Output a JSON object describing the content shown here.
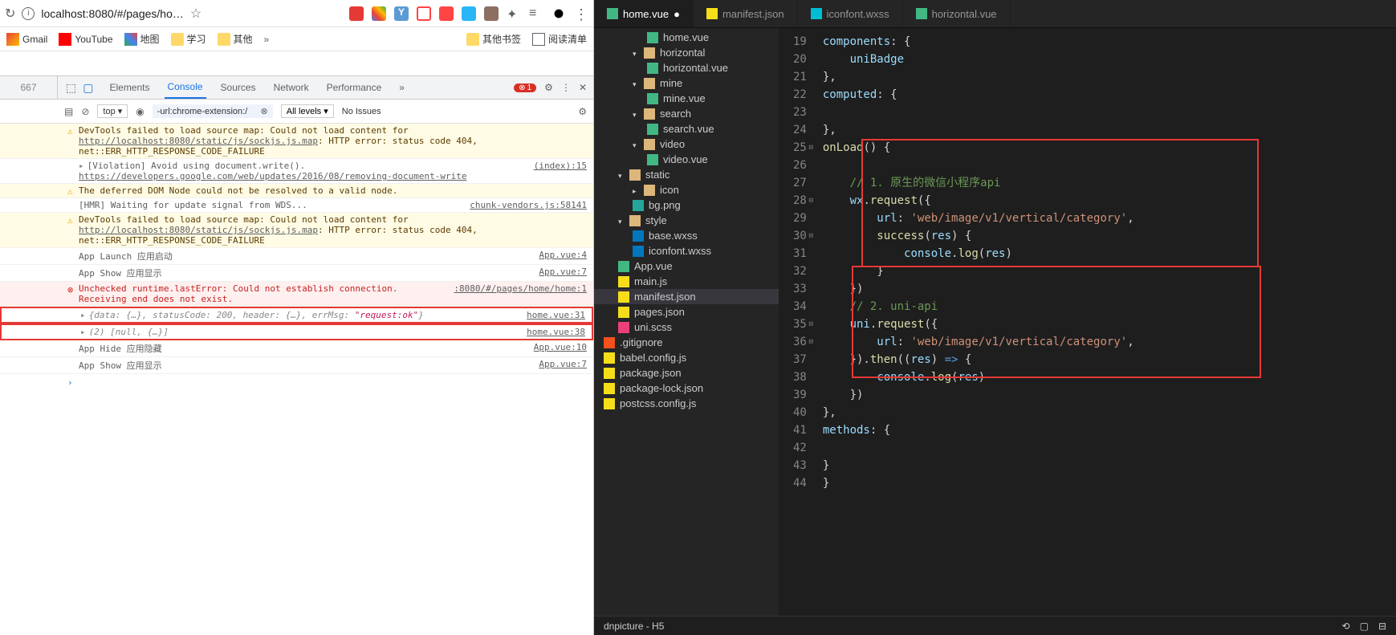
{
  "chrome": {
    "url": "localhost:8080/#/pages/ho…",
    "bookmarks": {
      "gmail": "Gmail",
      "youtube": "YouTube",
      "map": "地图",
      "study": "学习",
      "other": "其他",
      "other_bm": "其他书签",
      "reading": "阅读清单"
    },
    "side_num": "667"
  },
  "devtools": {
    "tabs": {
      "elements": "Elements",
      "console": "Console",
      "sources": "Sources",
      "network": "Network",
      "performance": "Performance"
    },
    "more": "»",
    "err_count": "1",
    "context": "top ▾",
    "filter": "-url:chrome-extension:/",
    "levels": "All levels ▾",
    "issues": "No Issues"
  },
  "console_msgs": {
    "m1": "DevTools failed to load source map: Could not load content for ",
    "m1_link": "http://localhost:8080/static/js/sockjs.js.map",
    "m1_tail": ": HTTP error: status code 404, net::ERR_HTTP_RESPONSE_CODE_FAILURE",
    "m2": "[Violation] Avoid using document.write(). ",
    "m2_link": "https://developers.google.com/web/updates/2016/08/removing-document-write",
    "m2_src": "(index):15",
    "m3": "The deferred DOM Node could not be resolved to a valid node.",
    "m4": "[HMR] Waiting for update signal from WDS...",
    "m4_src": "chunk-vendors.js:58141",
    "m5": "DevTools failed to load source map: Could not load content for ",
    "m5_link": "http://localhost:8080/static/js/sockjs.js.map",
    "m5_tail": ": HTTP error: status code 404, net::ERR_HTTP_RESPONSE_CODE_FAILURE",
    "m6": "App Launch 应用启动",
    "m6_src": "App.vue:4",
    "m7": "App Show 应用显示",
    "m7_src": "App.vue:7",
    "m8": "Unchecked runtime.lastError: Could not establish connection. Receiving end does not exist.",
    "m8_src": ":8080/#/pages/home/home:1",
    "m9a": "{data: {…}, statusCode: 200, header: {…}, errMsg: ",
    "m9b": "\"request:ok\"",
    "m9c": "}",
    "m9_src": "home.vue:31",
    "m10": "(2) [null, {…}]",
    "m10_src": "home.vue:38",
    "m11": "App Hide 应用隐藏",
    "m11_src": "App.vue:10",
    "m12": "App Show 应用显示",
    "m12_src": "App.vue:7"
  },
  "vsc": {
    "tabs": {
      "home": "home.vue",
      "manifest": "manifest.json",
      "iconfont": "iconfont.wxss",
      "horizontal": "horizontal.vue"
    },
    "explorer": {
      "home_vue": "home.vue",
      "horizontal": "horizontal",
      "horizontal_vue": "horizontal.vue",
      "mine": "mine",
      "mine_vue": "mine.vue",
      "search": "search",
      "search_vue": "search.vue",
      "video": "video",
      "video_vue": "video.vue",
      "static": "static",
      "icon": "icon",
      "bg_png": "bg.png",
      "style": "style",
      "base_wxss": "base.wxss",
      "iconfont_wxss": "iconfont.wxss",
      "app_vue": "App.vue",
      "main_js": "main.js",
      "manifest_json": "manifest.json",
      "pages_json": "pages.json",
      "uni_scss": "uni.scss",
      "gitignore": ".gitignore",
      "babel": "babel.config.js",
      "pkg": "package.json",
      "pkglock": "package-lock.json",
      "postcss": "postcss.config.js"
    },
    "lines": [
      "19",
      "20",
      "21",
      "22",
      "23",
      "24",
      "25",
      "26",
      "27",
      "28",
      "29",
      "30",
      "31",
      "32",
      "33",
      "34",
      "35",
      "36",
      "37",
      "38",
      "39",
      "40",
      "41",
      "42",
      "43",
      "44"
    ],
    "code": {
      "l19": "    components: {",
      "l20": "        uniBadge",
      "l21": "    },",
      "l22": "    computed: {",
      "l23": "",
      "l24": "    },",
      "l25": "    onLoad() {",
      "l26": "",
      "l27_c": "        // 1. 原生的微信小程序api",
      "l28": "        wx.request({",
      "l29": "            url: 'web/image/v1/vertical/category',",
      "l30": "            success(res) {",
      "l31": "                console.log(res)",
      "l32": "            }",
      "l33": "        })",
      "l34_c": "        // 2. uni-api",
      "l35": "        uni.request({",
      "l36": "            url: 'web/image/v1/vertical/category',",
      "l37": "        }).then((res) => {",
      "l38": "            console.log(res)",
      "l39": "        })",
      "l40": "    },",
      "l41": "    methods: {",
      "l42": "",
      "l43": "    }",
      "l44": "}"
    },
    "statusbar": "dnpicture - H5"
  }
}
